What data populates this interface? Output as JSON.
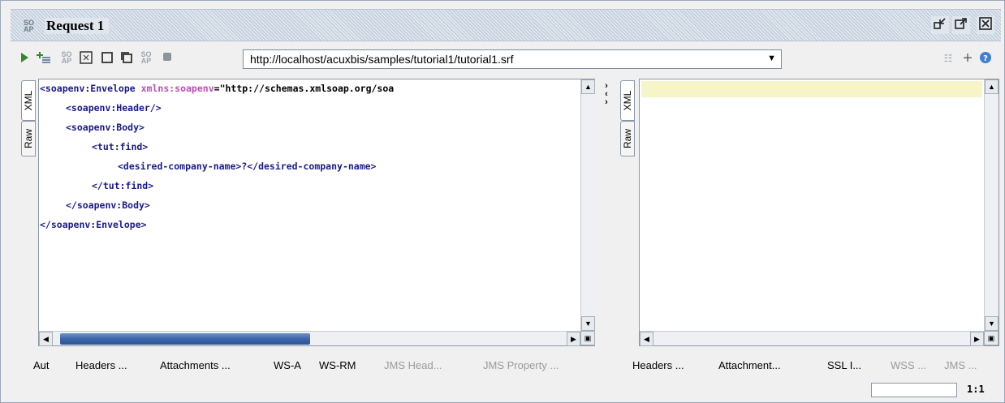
{
  "window": {
    "title": "Request 1",
    "title_icon_text": "SO AP",
    "controls": [
      "restore-down",
      "maximize",
      "close"
    ]
  },
  "toolbar": {
    "icons": [
      "submit-request-icon",
      "add-assertion-icon",
      "soap-icon",
      "maximize-editor-icon",
      "editor-view-icon",
      "copy-icon",
      "soap-gray-icon",
      "stop-icon"
    ],
    "endpoint_url": "http://localhost/acuxbis/samples/tutorial1/tutorial1.srf",
    "right_icons": [
      "tabs-icon",
      "add-icon",
      "help-icon"
    ]
  },
  "request_editor": {
    "side_tabs": [
      "XML",
      "Raw"
    ],
    "active_side_tab": "XML",
    "lines": [
      {
        "indent": 0,
        "parts": [
          {
            "t": "tag",
            "v": "<soapenv:Envelope "
          },
          {
            "t": "attr",
            "v": "xmlns:soapenv"
          },
          {
            "t": "val",
            "v": "=\"http://schemas.xmlsoap.org/soa"
          }
        ]
      },
      {
        "indent": 1,
        "parts": [
          {
            "t": "tag",
            "v": "<soapenv:Header/>"
          }
        ]
      },
      {
        "indent": 1,
        "parts": [
          {
            "t": "tag",
            "v": "<soapenv:Body>"
          }
        ]
      },
      {
        "indent": 2,
        "parts": [
          {
            "t": "tag",
            "v": "<tut:find>"
          }
        ]
      },
      {
        "indent": 3,
        "parts": [
          {
            "t": "tag",
            "v": "<desired-company-name>?</desired-company-name>"
          }
        ]
      },
      {
        "indent": 2,
        "parts": [
          {
            "t": "tag",
            "v": "</tut:find>"
          }
        ]
      },
      {
        "indent": 1,
        "parts": [
          {
            "t": "tag",
            "v": "</soapenv:Body>"
          }
        ]
      },
      {
        "indent": 0,
        "parts": [
          {
            "t": "tag",
            "v": "</soapenv:Envelope>"
          }
        ]
      }
    ],
    "horizontal_scroll_fraction": 0.2,
    "bottom_tabs": [
      {
        "label": "Aut",
        "enabled": true
      },
      {
        "label": "Headers ...",
        "enabled": true
      },
      {
        "label": "Attachments ...",
        "enabled": true
      },
      {
        "label": "WS-A",
        "enabled": true
      },
      {
        "label": "WS-RM",
        "enabled": true
      },
      {
        "label": "JMS Head...",
        "enabled": false
      },
      {
        "label": "JMS Property ...",
        "enabled": false
      }
    ]
  },
  "response_editor": {
    "side_tabs": [
      "XML",
      "Raw"
    ],
    "active_side_tab": "XML",
    "bottom_tabs": [
      {
        "label": "Headers ...",
        "enabled": true
      },
      {
        "label": "Attachment...",
        "enabled": true
      },
      {
        "label": "SSL I...",
        "enabled": true
      },
      {
        "label": "WSS ...",
        "enabled": false
      },
      {
        "label": "JMS ...",
        "enabled": false
      }
    ]
  },
  "status_bar": {
    "cursor_position": "1:1"
  },
  "colors": {
    "tag": "#1a1a8a",
    "attribute": "#c24db6",
    "highlight_line": "#f5f5c8",
    "scroll_thumb": "#3b65a8"
  }
}
